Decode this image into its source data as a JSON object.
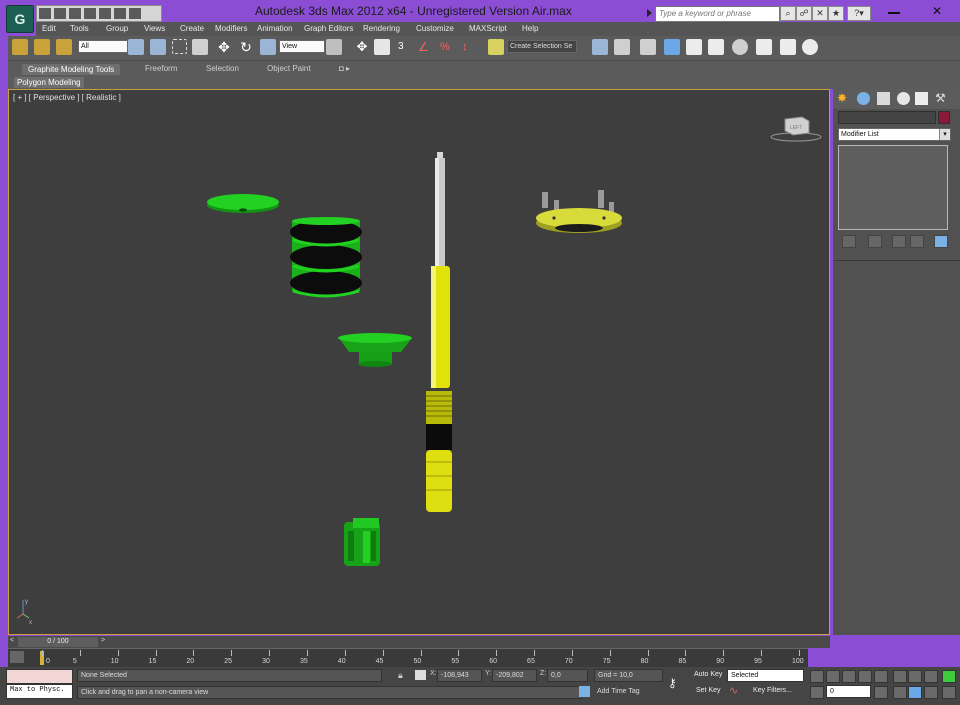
{
  "app": {
    "title": "Autodesk 3ds Max  2012 x64  - Unregistered Version     Air.max",
    "logo_text": "G",
    "search_placeholder": "Type a keyword or phrase"
  },
  "menus": [
    "Edit",
    "Tools",
    "Group",
    "Views",
    "Create",
    "Modifiers",
    "Animation",
    "Graph Editors",
    "Rendering",
    "Customize",
    "MAXScript",
    "Help"
  ],
  "toolbar": {
    "selection_filter": "All",
    "ref_coord": "View",
    "named_selection": "Create Selection Se"
  },
  "ribbon": {
    "tabs": [
      "Graphite Modeling Tools",
      "Freeform",
      "Selection",
      "Object Paint"
    ],
    "active_tab": "Graphite Modeling Tools",
    "panel_label": "Polygon Modeling",
    "extra": "◘ ▸"
  },
  "viewport": {
    "label": "[ + ] [ Perspective ] [ Realistic ]",
    "viewcube_label": "LEFT",
    "axis_y": "y",
    "axis_x": "x"
  },
  "command_panel": {
    "modifier_list": "Modifier List"
  },
  "timeline": {
    "slider_text": "0 / 100",
    "prev": "<",
    "next": ">",
    "ticks": [
      "0",
      "5",
      "10",
      "15",
      "20",
      "25",
      "30",
      "35",
      "40",
      "45",
      "50",
      "55",
      "60",
      "65",
      "70",
      "75",
      "80",
      "85",
      "90",
      "95",
      "100"
    ]
  },
  "status": {
    "maxscript_listener": "Max to Physc.",
    "selection": "None Selected",
    "prompt": "Click and drag to pan a non-camera view",
    "x_label": "X:",
    "x_value": "-108,943",
    "y_label": "Y:",
    "y_value": "-209,802",
    "z_label": "Z:",
    "z_value": "0,0",
    "grid": "Grid = 10,0",
    "add_time_tag": "Add Time Tag",
    "auto_key": "Auto Key",
    "set_key": "Set Key",
    "key_mode": "Selected",
    "key_filters": "Key Filters...",
    "frame": "0"
  },
  "colors": {
    "accent_window": "#8a4dd4",
    "viewport_bg": "#3e3e3e",
    "viewport_border": "#c8a03c",
    "green_object": "#1ec81e",
    "yellow_object": "#e1e20a",
    "swatch": "#8b1a3a"
  }
}
